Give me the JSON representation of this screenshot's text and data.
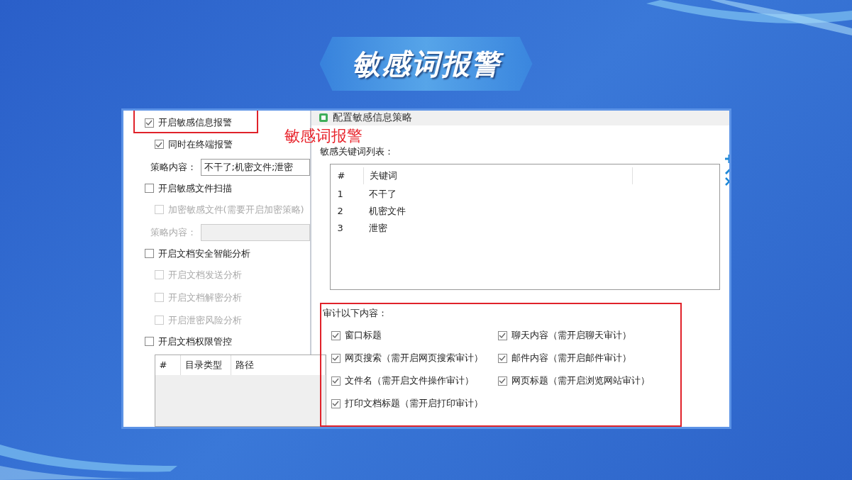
{
  "banner": {
    "title": "敏感词报警"
  },
  "annotation": {
    "text": "敏感词报警"
  },
  "left_panel": {
    "options": [
      {
        "kind": "checkbox",
        "label": "开启敏感信息报警",
        "checked": true,
        "disabled": false,
        "highlighted": true,
        "children": [
          {
            "kind": "checkbox",
            "label": "同时在终端报警",
            "checked": true,
            "disabled": false
          },
          {
            "kind": "field",
            "label": "策略内容：",
            "value": "不干了;机密文件;泄密",
            "disabled": false
          }
        ]
      },
      {
        "kind": "checkbox",
        "label": "开启敏感文件扫描",
        "checked": false,
        "disabled": false,
        "highlighted": false,
        "children": [
          {
            "kind": "checkbox",
            "label": "加密敏感文件(需要开启加密策略)",
            "checked": false,
            "disabled": true
          },
          {
            "kind": "field",
            "label": "策略内容：",
            "disabled": true
          }
        ]
      },
      {
        "kind": "checkbox",
        "label": "开启文档安全智能分析",
        "checked": false,
        "disabled": false,
        "highlighted": false,
        "children": [
          {
            "kind": "checkbox",
            "label": "开启文档发送分析",
            "checked": false,
            "disabled": true
          },
          {
            "kind": "checkbox",
            "label": "开启文档解密分析",
            "checked": false,
            "disabled": true
          },
          {
            "kind": "checkbox",
            "label": "开启泄密风险分析",
            "checked": false,
            "disabled": true
          }
        ]
      },
      {
        "kind": "checkbox",
        "label": "开启文档权限管控",
        "checked": false,
        "disabled": false,
        "highlighted": false,
        "children": [
          {
            "kind": "table",
            "columns": [
              "#",
              "目录类型",
              "路径"
            ]
          }
        ]
      }
    ]
  },
  "dialog": {
    "title": "配置敏感信息策略",
    "keyword_list": {
      "label": "敏感关键词列表：",
      "columns": [
        "#",
        "关键词"
      ],
      "rows": [
        [
          "1",
          "不干了"
        ],
        [
          "2",
          "机密文件"
        ],
        [
          "3",
          "泄密"
        ]
      ]
    },
    "audit": {
      "label": "审计以下内容：",
      "highlighted": true,
      "items": [
        {
          "label": "窗口标题",
          "checked": true
        },
        {
          "label": "聊天内容（需开启聊天审计）",
          "checked": true
        },
        {
          "label": "网页搜索（需开启网页搜索审计）",
          "checked": true
        },
        {
          "label": "邮件内容（需开启邮件审计）",
          "checked": true
        },
        {
          "label": "文件名（需开启文件操作审计）",
          "checked": true
        },
        {
          "label": "网页标题（需开启浏览网站审计）",
          "checked": true
        },
        {
          "label": "打印文档标题（需开启打印审计）",
          "checked": true
        }
      ]
    }
  }
}
